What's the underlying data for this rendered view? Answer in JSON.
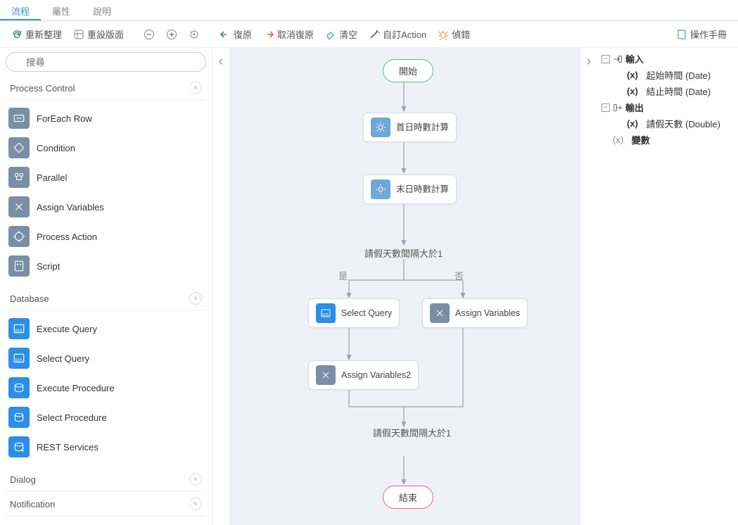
{
  "tabs": {
    "flow": "流程",
    "props": "屬性",
    "help": "說明"
  },
  "toolbar": {
    "refresh": "重新整理",
    "resetLayout": "重設版面",
    "undo": "復原",
    "redo": "取消復原",
    "clear": "清空",
    "customAction": "自訂Action",
    "debug": "偵錯",
    "manual": "操作手冊"
  },
  "search": {
    "placeholder": "搜尋"
  },
  "palette": {
    "groups": [
      {
        "name": "Process Control",
        "open": true,
        "iconStyle": "grey",
        "items": [
          {
            "label": "ForEach Row",
            "icon": "foreach"
          },
          {
            "label": "Condition",
            "icon": "condition"
          },
          {
            "label": "Parallel",
            "icon": "parallel"
          },
          {
            "label": "Assign Variables",
            "icon": "assign"
          },
          {
            "label": "Process Action",
            "icon": "procact"
          },
          {
            "label": "Script",
            "icon": "script"
          }
        ]
      },
      {
        "name": "Database",
        "open": true,
        "iconStyle": "blue",
        "items": [
          {
            "label": "Execute Query",
            "icon": "exeq"
          },
          {
            "label": "Select Query",
            "icon": "selq"
          },
          {
            "label": "Execute Procedure",
            "icon": "exep"
          },
          {
            "label": "Select Procedure",
            "icon": "selp"
          },
          {
            "label": "REST Services",
            "icon": "rest"
          }
        ]
      },
      {
        "name": "Dialog",
        "open": false,
        "items": []
      },
      {
        "name": "Notification",
        "open": false,
        "items": []
      }
    ]
  },
  "flow": {
    "start": "開始",
    "end": "結束",
    "n1": "首日時數計算",
    "n2": "末日時數計算",
    "cond1": "請假天數間隔大於1",
    "branchYes": "是",
    "branchNo": "否",
    "nSelect": "Select Query",
    "nAssignR": "Assign Variables",
    "nAssign2": "Assign Variables2",
    "merge": "請假天數間隔大於1"
  },
  "vars": {
    "input": "輸入",
    "output": "輸出",
    "startTime": "起始時間 (Date)",
    "endTime": "結止時間 (Date)",
    "leaveDays": "請假天數 (Double)",
    "var": "變數",
    "x": "(x)"
  }
}
